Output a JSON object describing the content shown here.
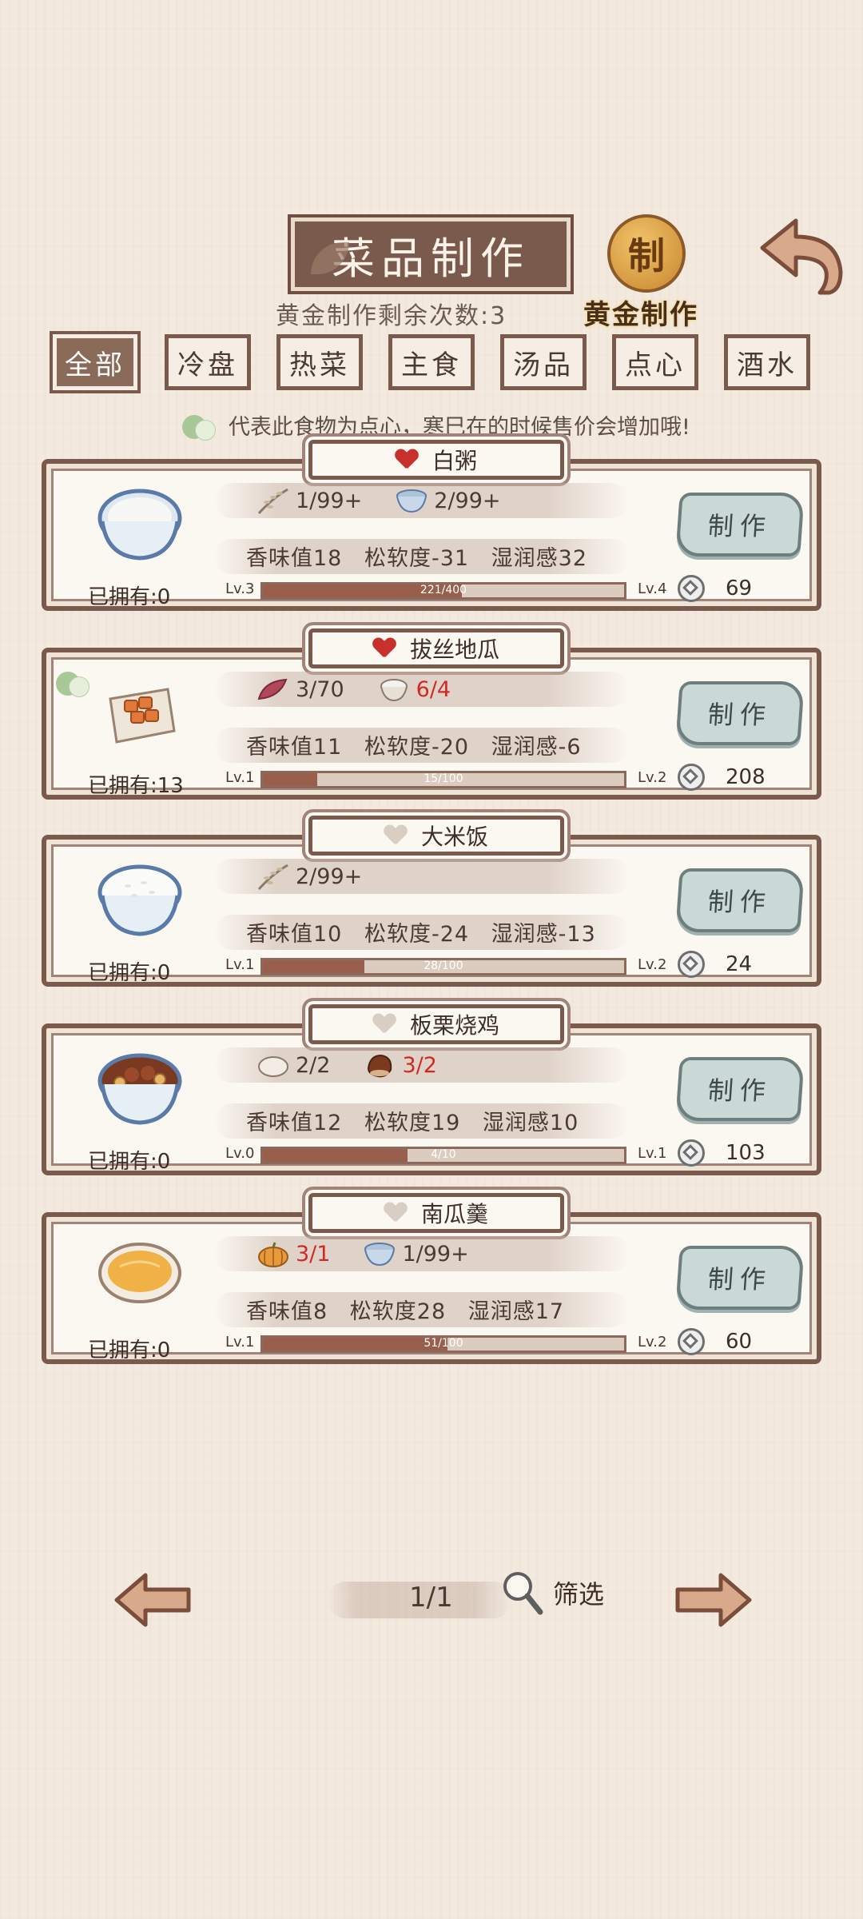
{
  "header": {
    "title": "菜品制作",
    "gold_remaining": "黄金制作剩余次数:3",
    "gold_seal_char": "制",
    "gold_label": "黄金制作"
  },
  "tabs": [
    {
      "label": "全部",
      "active": true
    },
    {
      "label": "冷盘",
      "active": false
    },
    {
      "label": "热菜",
      "active": false
    },
    {
      "label": "主食",
      "active": false
    },
    {
      "label": "汤品",
      "active": false
    },
    {
      "label": "点心",
      "active": false
    },
    {
      "label": "酒水",
      "active": false
    }
  ],
  "hint": "代表此食物为点心，寒巳在的时候售价会增加哦!",
  "recipes": [
    {
      "name": "白粥",
      "favorite": true,
      "dessert": false,
      "owned": "已拥有:0",
      "ingredients": [
        {
          "icon": "rice-stalk-icon",
          "amount": "1/99+",
          "short": false
        },
        {
          "icon": "bowl-icon",
          "amount": "2/99+",
          "short": false
        }
      ],
      "stats": {
        "aroma": "香味值18",
        "softness": "松软度-31",
        "moisture": "湿润感32"
      },
      "level": "Lv.3",
      "next_level": "Lv.4",
      "progress": "221/400",
      "progress_fraction": 0.55,
      "make": "制作",
      "price": "69"
    },
    {
      "name": "拔丝地瓜",
      "favorite": true,
      "dessert": true,
      "owned": "已拥有:13",
      "ingredients": [
        {
          "icon": "sweet-potato-icon",
          "amount": "3/70",
          "short": false
        },
        {
          "icon": "sugar-bowl-icon",
          "amount": "6/4",
          "short": true
        }
      ],
      "stats": {
        "aroma": "香味值11",
        "softness": "松软度-20",
        "moisture": "湿润感-6"
      },
      "level": "Lv.1",
      "next_level": "Lv.2",
      "progress": "15/100",
      "progress_fraction": 0.15,
      "make": "制作",
      "price": "208"
    },
    {
      "name": "大米饭",
      "favorite": false,
      "dessert": false,
      "owned": "已拥有:0",
      "ingredients": [
        {
          "icon": "rice-stalk-icon",
          "amount": "2/99+",
          "short": false
        }
      ],
      "stats": {
        "aroma": "香味值10",
        "softness": "松软度-24",
        "moisture": "湿润感-13"
      },
      "level": "Lv.1",
      "next_level": "Lv.2",
      "progress": "28/100",
      "progress_fraction": 0.28,
      "make": "制作",
      "price": "24"
    },
    {
      "name": "板栗烧鸡",
      "favorite": false,
      "dessert": false,
      "owned": "已拥有:0",
      "ingredients": [
        {
          "icon": "chicken-icon",
          "amount": "2/2",
          "short": false
        },
        {
          "icon": "chestnut-icon",
          "amount": "3/2",
          "short": true
        }
      ],
      "stats": {
        "aroma": "香味值12",
        "softness": "松软度19",
        "moisture": "湿润感10"
      },
      "level": "Lv.0",
      "next_level": "Lv.1",
      "progress": "4/10",
      "progress_fraction": 0.4,
      "make": "制作",
      "price": "103"
    },
    {
      "name": "南瓜羹",
      "favorite": false,
      "dessert": false,
      "owned": "已拥有:0",
      "ingredients": [
        {
          "icon": "pumpkin-icon",
          "amount": "3/1",
          "short": true
        },
        {
          "icon": "bowl-icon",
          "amount": "1/99+",
          "short": false
        }
      ],
      "stats": {
        "aroma": "香味值8",
        "softness": "松软度28",
        "moisture": "湿润感17"
      },
      "level": "Lv.1",
      "next_level": "Lv.2",
      "progress": "51/100",
      "progress_fraction": 0.51,
      "make": "制作",
      "price": "60"
    }
  ],
  "pager": {
    "page": "1/1",
    "filter": "筛选"
  }
}
